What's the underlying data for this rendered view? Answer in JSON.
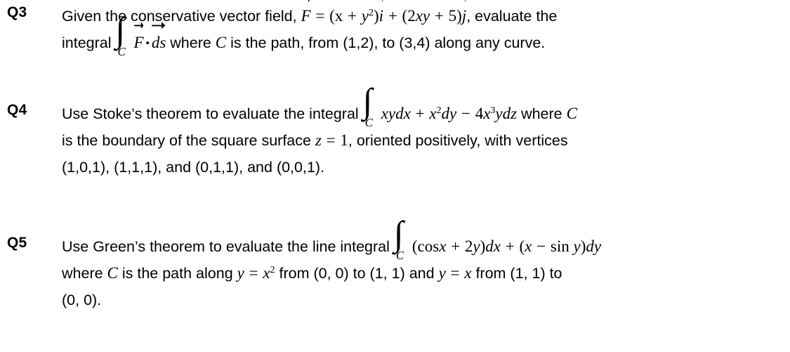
{
  "document": {
    "background": "#ffffff",
    "text_color": "#000000"
  },
  "questions": [
    {
      "label": "Q3",
      "lines": [
        {
          "segments": [
            {
              "t": "text",
              "v": "Given the conservative vector field, "
            },
            {
              "t": "vec",
              "v": "F"
            },
            {
              "t": "op",
              "v": "="
            },
            {
              "t": "mu",
              "v": "(x"
            },
            {
              "t": "op",
              "v": "+"
            },
            {
              "t": "mi",
              "v": "y"
            },
            {
              "t": "sup",
              "v": "2"
            },
            {
              "t": "mu",
              "v": ")"
            },
            {
              "t": "vec",
              "v": "i"
            },
            {
              "t": "op",
              "v": "+"
            },
            {
              "t": "mu",
              "v": "(2"
            },
            {
              "t": "mi",
              "v": "xy"
            },
            {
              "t": "op",
              "v": "+"
            },
            {
              "t": "mu",
              "v": "5)"
            },
            {
              "t": "vec",
              "v": "j"
            },
            {
              "t": "text",
              "v": ", evaluate the"
            }
          ]
        },
        {
          "segments": [
            {
              "t": "text",
              "v": "integral "
            },
            {
              "t": "integral",
              "v": "C"
            },
            {
              "t": "vec",
              "v": "F"
            },
            {
              "t": "dot",
              "v": "•"
            },
            {
              "t": "vecds",
              "v": "ds"
            },
            {
              "t": "text",
              "v": " where "
            },
            {
              "t": "mi",
              "v": "C"
            },
            {
              "t": "text",
              "v": "  is the path, from (1,2), to (3,4) along any curve."
            }
          ]
        }
      ]
    },
    {
      "label": "Q4",
      "lines": [
        {
          "segments": [
            {
              "t": "text",
              "v": "Use Stoke’s theorem to evaluate the integral "
            },
            {
              "t": "integral",
              "v": "C"
            },
            {
              "t": "mi",
              "v": "xydx"
            },
            {
              "t": "op",
              "v": "+"
            },
            {
              "t": "mi",
              "v": "x"
            },
            {
              "t": "sup",
              "v": "2"
            },
            {
              "t": "mi",
              "v": "dy"
            },
            {
              "t": "op",
              "v": "−"
            },
            {
              "t": "mu",
              "v": "4"
            },
            {
              "t": "mi",
              "v": "x"
            },
            {
              "t": "sup",
              "v": "3"
            },
            {
              "t": "mi",
              "v": "ydz"
            },
            {
              "t": "text",
              "v": "  where "
            },
            {
              "t": "mi",
              "v": "C"
            }
          ]
        },
        {
          "justify": true,
          "segments": [
            {
              "t": "text",
              "v": "is the boundary of the square surface "
            },
            {
              "t": "mi",
              "v": "z"
            },
            {
              "t": "op",
              "v": "="
            },
            {
              "t": "mu",
              "v": "1"
            },
            {
              "t": "text",
              "v": ", oriented positively,  with vertices"
            }
          ]
        },
        {
          "segments": [
            {
              "t": "text",
              "v": "(1,0,1), (1,1,1), and (0,1,1), and (0,0,1)."
            }
          ]
        }
      ]
    },
    {
      "label": "Q5",
      "lines": [
        {
          "segments": [
            {
              "t": "text",
              "v": "Use Green’s theorem to evaluate the line integral "
            },
            {
              "t": "integral",
              "v": "C"
            },
            {
              "t": "mu",
              "v": "(cos"
            },
            {
              "t": "mi",
              "v": "x"
            },
            {
              "t": "op",
              "v": "+"
            },
            {
              "t": "mu",
              "v": "2"
            },
            {
              "t": "mi",
              "v": "y"
            },
            {
              "t": "mu",
              "v": ")"
            },
            {
              "t": "mi",
              "v": "dx"
            },
            {
              "t": "op",
              "v": "+"
            },
            {
              "t": "mu",
              "v": "("
            },
            {
              "t": "mi",
              "v": "x"
            },
            {
              "t": "op",
              "v": "−"
            },
            {
              "t": "mu",
              "v": "sin "
            },
            {
              "t": "mi",
              "v": "y"
            },
            {
              "t": "mu",
              "v": ")"
            },
            {
              "t": "mi",
              "v": "dy"
            }
          ]
        },
        {
          "segments": [
            {
              "t": "text",
              "v": "where "
            },
            {
              "t": "mi",
              "v": "C"
            },
            {
              "t": "text",
              "v": "  is the path along "
            },
            {
              "t": "mi",
              "v": "y"
            },
            {
              "t": "op",
              "v": "="
            },
            {
              "t": "mi",
              "v": "x"
            },
            {
              "t": "sup",
              "v": "2"
            },
            {
              "t": "text",
              "v": " from (0, 0) to (1, 1) and "
            },
            {
              "t": "mi",
              "v": "y"
            },
            {
              "t": "op",
              "v": "="
            },
            {
              "t": "mi",
              "v": "x"
            },
            {
              "t": "text",
              "v": "  from (1, 1) to"
            }
          ]
        },
        {
          "segments": [
            {
              "t": "text",
              "v": "(0, 0)."
            }
          ]
        }
      ]
    }
  ]
}
